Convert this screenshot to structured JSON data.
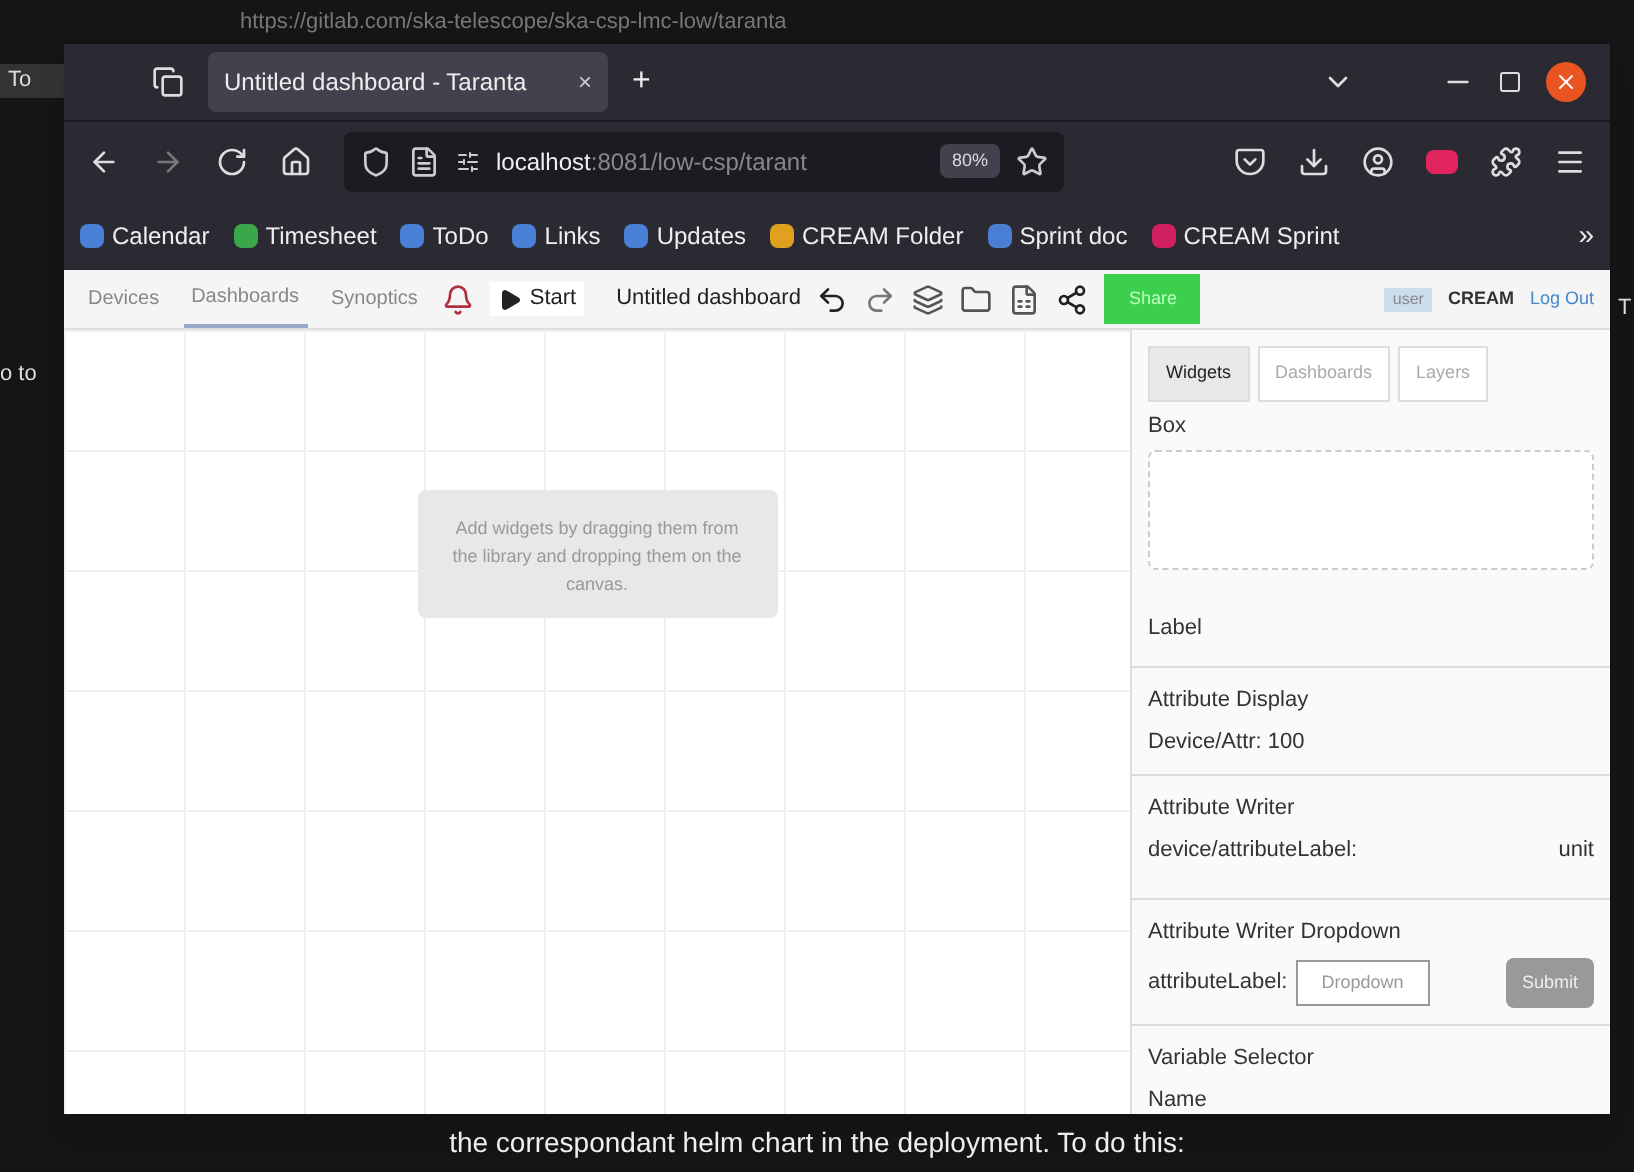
{
  "background": {
    "url": "https://gitlab.com/ska-telescope/ska-csp-lmc-low/taranta",
    "left_fragments": [
      "To",
      "o to"
    ],
    "right_fragment": "T",
    "caption": "the correspondant helm chart in the deployment. To do this:"
  },
  "browser": {
    "tab": {
      "title": "Untitled dashboard - Taranta",
      "close": "×"
    },
    "new_tab": "+",
    "address": {
      "host": "localhost",
      "path": ":8081/low-csp/tarant",
      "zoom": "80%"
    },
    "bookmarks": [
      {
        "label": "Calendar",
        "color": "#4a7fd6"
      },
      {
        "label": "Timesheet",
        "color": "#3aa84a"
      },
      {
        "label": "ToDo",
        "color": "#4a7fd6"
      },
      {
        "label": "Links",
        "color": "#4a7fd6"
      },
      {
        "label": "Updates",
        "color": "#4a7fd6"
      },
      {
        "label": "CREAM Folder",
        "color": "#e0a020"
      },
      {
        "label": "Sprint doc",
        "color": "#4a7fd6"
      },
      {
        "label": "CREAM Sprint",
        "color": "#d02060"
      }
    ],
    "more": "»"
  },
  "app": {
    "nav": [
      {
        "label": "Devices",
        "selected": false
      },
      {
        "label": "Dashboards",
        "selected": true
      },
      {
        "label": "Synoptics",
        "selected": false
      }
    ],
    "start": "Start",
    "dashboard_name": "Untitled dashboard",
    "share_button": "Share",
    "user": "user",
    "group": "CREAM",
    "logout": "Log Out",
    "canvas_hint": "Add widgets by dragging them from the library and dropping them on the canvas.",
    "panel_tabs": [
      {
        "label": "Widgets",
        "selected": true
      },
      {
        "label": "Dashboards",
        "selected": false
      },
      {
        "label": "Layers",
        "selected": false
      }
    ],
    "widgets": [
      {
        "kind": "box",
        "title": "Box"
      },
      {
        "kind": "label",
        "title": "Label"
      },
      {
        "kind": "display",
        "title": "Attribute Display",
        "text": "Device/Attr: 100"
      },
      {
        "kind": "writer",
        "title": "Attribute Writer",
        "text": "device/attributeLabel:",
        "unit": "unit"
      },
      {
        "kind": "dropdown",
        "title": "Attribute Writer Dropdown",
        "text": "attributeLabel:",
        "dropdown": "Dropdown",
        "submit": "Submit"
      },
      {
        "kind": "selector",
        "title": "Variable Selector",
        "text": "Name"
      }
    ]
  }
}
